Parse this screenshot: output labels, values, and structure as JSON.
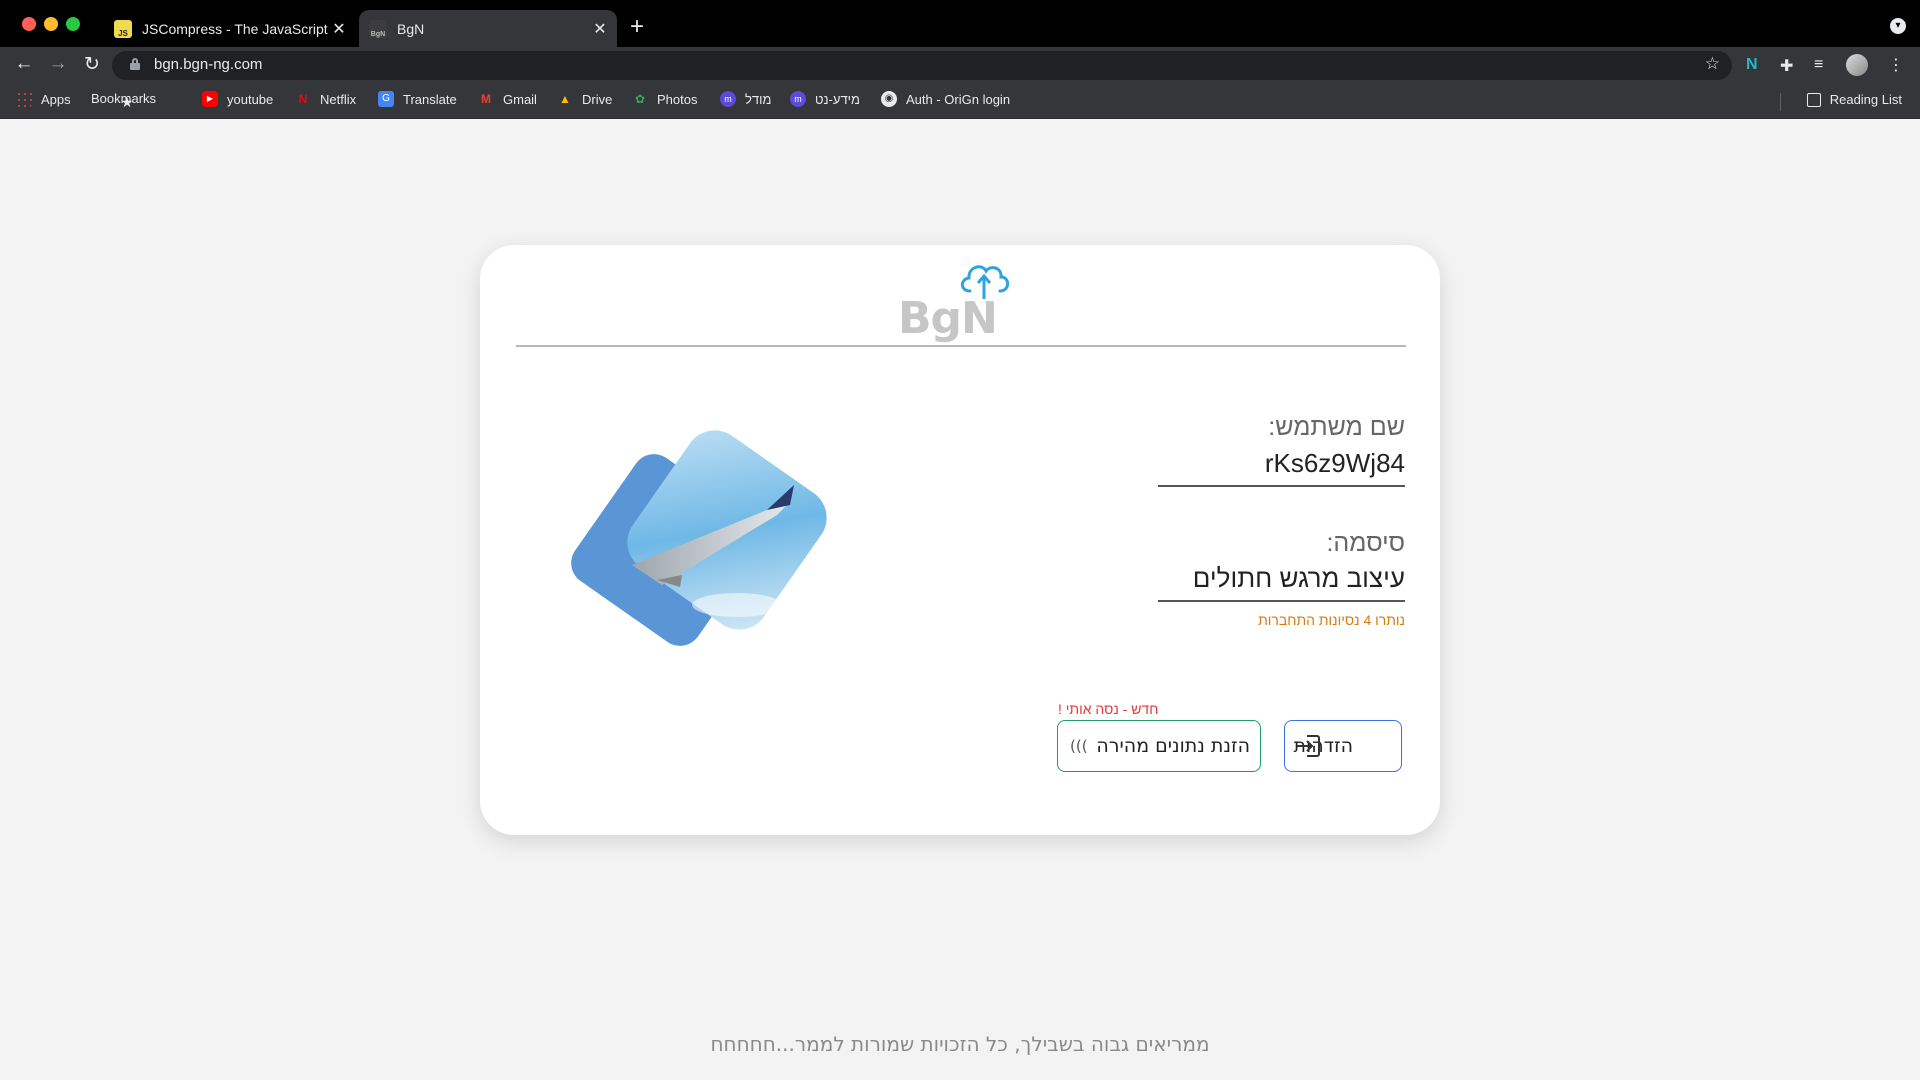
{
  "browser": {
    "tabs": [
      {
        "title": "JSCompress - The JavaScript Compression Tool",
        "favicon": "js-icon"
      },
      {
        "title": "BgN",
        "favicon": "bgn-icon",
        "active": true
      }
    ],
    "url": "bgn.bgn-ng.com",
    "bookmarks": [
      {
        "label": "Apps",
        "icon": "apps-grid-icon"
      },
      {
        "label": "Bookmarks",
        "icon": "star-icon"
      },
      {
        "label": "youtube",
        "icon": "youtube-icon"
      },
      {
        "label": "Netflix",
        "icon": "netflix-icon"
      },
      {
        "label": "Translate",
        "icon": "translate-icon"
      },
      {
        "label": "Gmail",
        "icon": "gmail-icon"
      },
      {
        "label": "Drive",
        "icon": "drive-icon"
      },
      {
        "label": "Photos",
        "icon": "photos-icon"
      },
      {
        "label": "מודל",
        "icon": "moodle-icon"
      },
      {
        "label": "מידע-נט",
        "icon": "meida-net-icon"
      },
      {
        "label": "Auth - OriGn login",
        "icon": "auth-icon"
      }
    ],
    "reading_list": "Reading List"
  },
  "login": {
    "logo_text": "BgN",
    "username_label": "שם משתמש:",
    "username_value": "rKs6z9Wj84",
    "password_label": "סיסמה:",
    "password_value": "עיצוב מרגש חתולים",
    "attempts_left": "נותרו 4 נסיונות התחברות",
    "new_hint": "חדש - נסה אותי !",
    "login_button": "הזדהות",
    "fast_entry_button": "הזנת נתונים מהירה"
  },
  "footer": "ממריאים גבוה בשבילך, כל הזכויות שמורות לממר...חחחחח",
  "colors": {
    "accent_blue": "#3b74d8",
    "accent_green": "#1f9c6a",
    "warning_orange": "#d57b10",
    "alert_red": "#e03a3a",
    "cloud_blue": "#2ea3e0"
  }
}
